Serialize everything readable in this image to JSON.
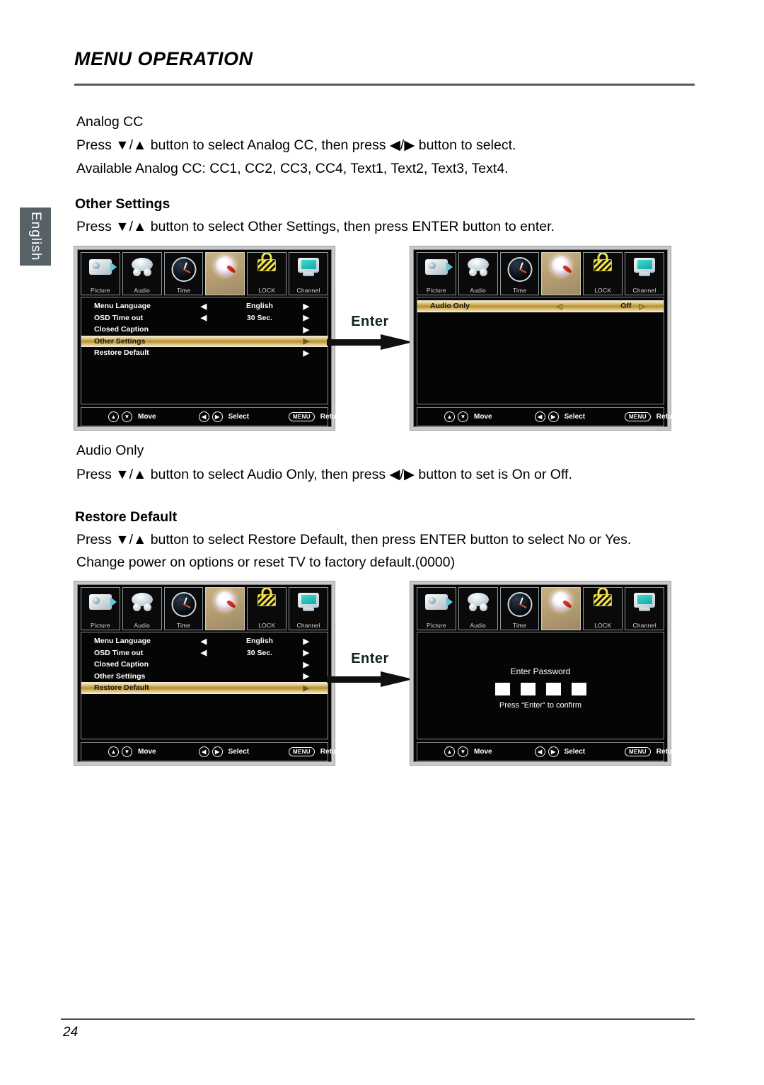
{
  "page": {
    "title": "MENU OPERATION",
    "number": "24",
    "language_tab": "English"
  },
  "sections": {
    "analog_cc": {
      "heading": "Analog CC",
      "line1": "Press ▼/▲ button to select Analog CC,  then press ◀/▶ button to select.",
      "line2": "Available Analog CC: CC1, CC2,  CC3, CC4, Text1, Text2, Text3, Text4."
    },
    "other_settings": {
      "heading": "Other Settings",
      "line1": "Press ▼/▲ button to select Other Settings, then press ENTER button to enter."
    },
    "audio_only": {
      "heading": "Audio Only",
      "line1": "Press ▼/▲ button to select Audio Only, then press ◀/▶ button to set is On or Off."
    },
    "restore_default": {
      "heading": "Restore Default",
      "line1": "Press ▼/▲ button to select Restore Default, then press ENTER button to select No or Yes.",
      "line2": "Change power on options or reset TV to factory default.(0000)"
    }
  },
  "enter_label_top": "Enter",
  "enter_label_bottom": "Enter",
  "icon_tabs": [
    {
      "label": "Picture",
      "icon": "camera-icon",
      "active": false
    },
    {
      "label": "Audio",
      "icon": "speaker-icon",
      "active": false
    },
    {
      "label": "Time",
      "icon": "clock-icon",
      "active": false
    },
    {
      "label": "",
      "icon": "setup-gear-icon",
      "active": true
    },
    {
      "label": "LOCK",
      "icon": "padlock-icon",
      "active": false
    },
    {
      "label": "Channel",
      "icon": "monitor-icon",
      "active": false
    }
  ],
  "osd_footer": {
    "up_icon": "▲",
    "down_icon": "▼",
    "left_icon": "◀",
    "right_icon": "▶",
    "menu_pill": "MENU",
    "move_label": "Move",
    "select_label": "Select",
    "return_label": "Return"
  },
  "menu_setup": {
    "rows": [
      {
        "label": "Menu Language",
        "left_arrow": "◀",
        "value": "English",
        "right_arrow": "▶",
        "highlight": false
      },
      {
        "label": "OSD Time out",
        "left_arrow": "◀",
        "value": "30 Sec.",
        "right_arrow": "▶",
        "highlight": false
      },
      {
        "label": "Closed Caption",
        "left_arrow": "",
        "value": "",
        "right_arrow": "▶",
        "highlight": false
      },
      {
        "label": "Other Settings",
        "left_arrow": "",
        "value": "",
        "right_arrow": "▶",
        "highlight": true
      },
      {
        "label": "Restore Default",
        "left_arrow": "",
        "value": "",
        "right_arrow": "▶",
        "highlight": false
      }
    ]
  },
  "menu_setup_restore": {
    "rows": [
      {
        "label": "Menu Language",
        "left_arrow": "◀",
        "value": "English",
        "right_arrow": "▶",
        "highlight": false
      },
      {
        "label": "OSD Time out",
        "left_arrow": "◀",
        "value": "30 Sec.",
        "right_arrow": "▶",
        "highlight": false
      },
      {
        "label": "Closed Caption",
        "left_arrow": "",
        "value": "",
        "right_arrow": "▶",
        "highlight": false
      },
      {
        "label": "Other Settings",
        "left_arrow": "",
        "value": "",
        "right_arrow": "▶",
        "highlight": false
      },
      {
        "label": "Restore Default",
        "left_arrow": "",
        "value": "",
        "right_arrow": "▶",
        "highlight": true
      }
    ]
  },
  "menu_audio_only": {
    "rows": [
      {
        "label": "Audio Only",
        "left_arrow": "◁",
        "value": "Off",
        "right_arrow": "▷",
        "highlight": true
      }
    ]
  },
  "password_panel": {
    "title": "Enter Password",
    "digits": [
      "",
      "",
      "",
      ""
    ],
    "hint": "Press “Enter” to confirm"
  }
}
